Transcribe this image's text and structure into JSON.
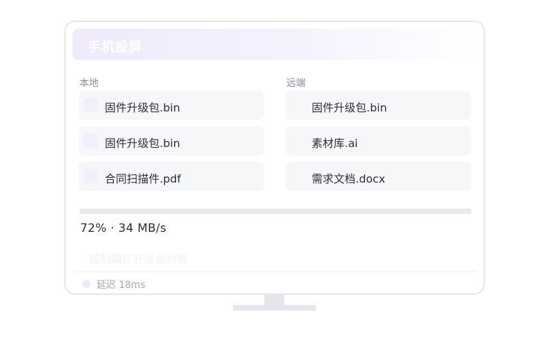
{
  "window": {
    "title": "手机投屏"
  },
  "local": {
    "label": "本地",
    "files": [
      {
        "name": "固件升级包.bin"
      },
      {
        "name": "固件升级包.bin"
      },
      {
        "name": "合同扫描件.pdf"
      }
    ]
  },
  "remote": {
    "label": "远端",
    "files": [
      {
        "name": "固件升级包.bin"
      },
      {
        "name": "素材库.ai"
      },
      {
        "name": "需求文档.docx"
      }
    ]
  },
  "transfer": {
    "progress_percent": 72,
    "status_text": "72% · 34 MB/s"
  },
  "hint": "控制端打开设备列表",
  "status": {
    "latency": "延迟 18ms"
  },
  "colors": {
    "accent_soft": "#efeafc",
    "border": "#e3e6ea",
    "item_bg": "#f6f7f9",
    "text": "#2b2f36",
    "muted": "#8a8f99"
  }
}
